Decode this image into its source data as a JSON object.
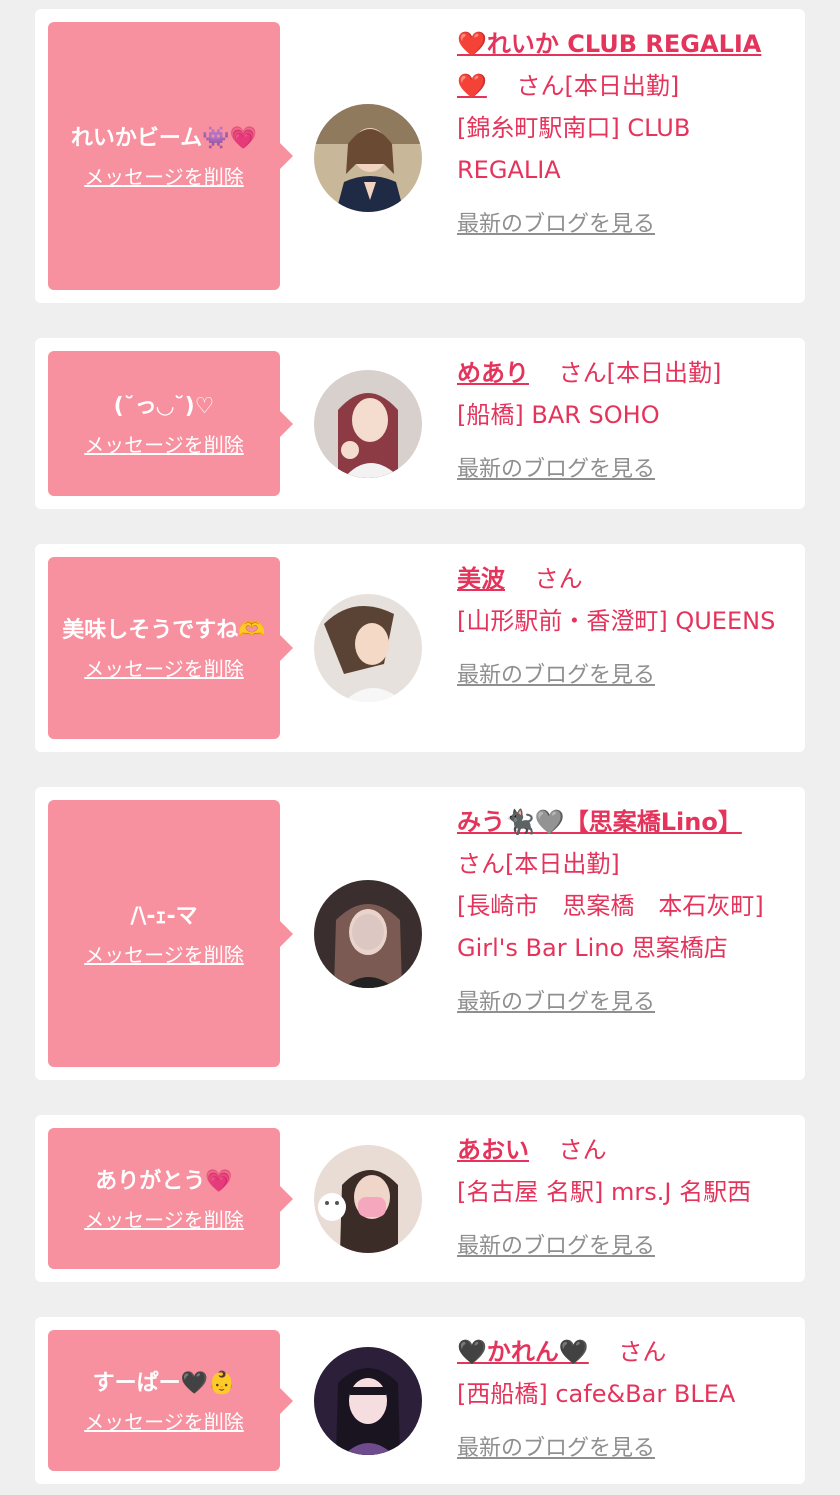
{
  "items": [
    {
      "message": "れいかビーム👾💗",
      "delete_label": "メッセージを削除",
      "name": "❤️れいか CLUB REGALIA❤️",
      "san": "さん",
      "status": "[本日出勤]",
      "shop": "[錦糸町駅南口] CLUB REGALIA",
      "blog_label": "最新のブログを見る"
    },
    {
      "message": "(˘っ◡˘)♡",
      "delete_label": "メッセージを削除",
      "name": "めあり",
      "san": "さん",
      "status": "[本日出勤]",
      "shop": "[船橋] BAR SOHO",
      "blog_label": "最新のブログを見る"
    },
    {
      "message": "美味しそうですね🫶",
      "delete_label": "メッセージを削除",
      "name": "美波",
      "san": "さん",
      "status": "",
      "shop": "[山形駅前・香澄町] QUEENS",
      "blog_label": "最新のブログを見る"
    },
    {
      "message": "/\\-ｪ-マ",
      "delete_label": "メッセージを削除",
      "name": "みう🐈‍⬛🩶【思案橋Lino】",
      "san": "さん",
      "status": "[本日出勤]",
      "shop": "[長崎市　思案橋　本石灰町] Girl's Bar Lino 思案橋店",
      "blog_label": "最新のブログを見る"
    },
    {
      "message": "ありがとう💗",
      "delete_label": "メッセージを削除",
      "name": "あおい",
      "san": "さん",
      "status": "",
      "shop": "[名古屋 名駅] mrs.J 名駅西",
      "blog_label": "最新のブログを見る"
    },
    {
      "message": "すーぱー🖤👶",
      "delete_label": "メッセージを削除",
      "name": "🖤かれん🖤",
      "san": "さん",
      "status": "",
      "shop": "[西船橋] cafe&Bar BLEA",
      "blog_label": "最新のブログを見る"
    }
  ],
  "colors": {
    "background": "#efefef",
    "card": "#ffffff",
    "bubble": "#f7919f",
    "accent": "#e5345c",
    "link_gray": "#8f8f8f"
  }
}
